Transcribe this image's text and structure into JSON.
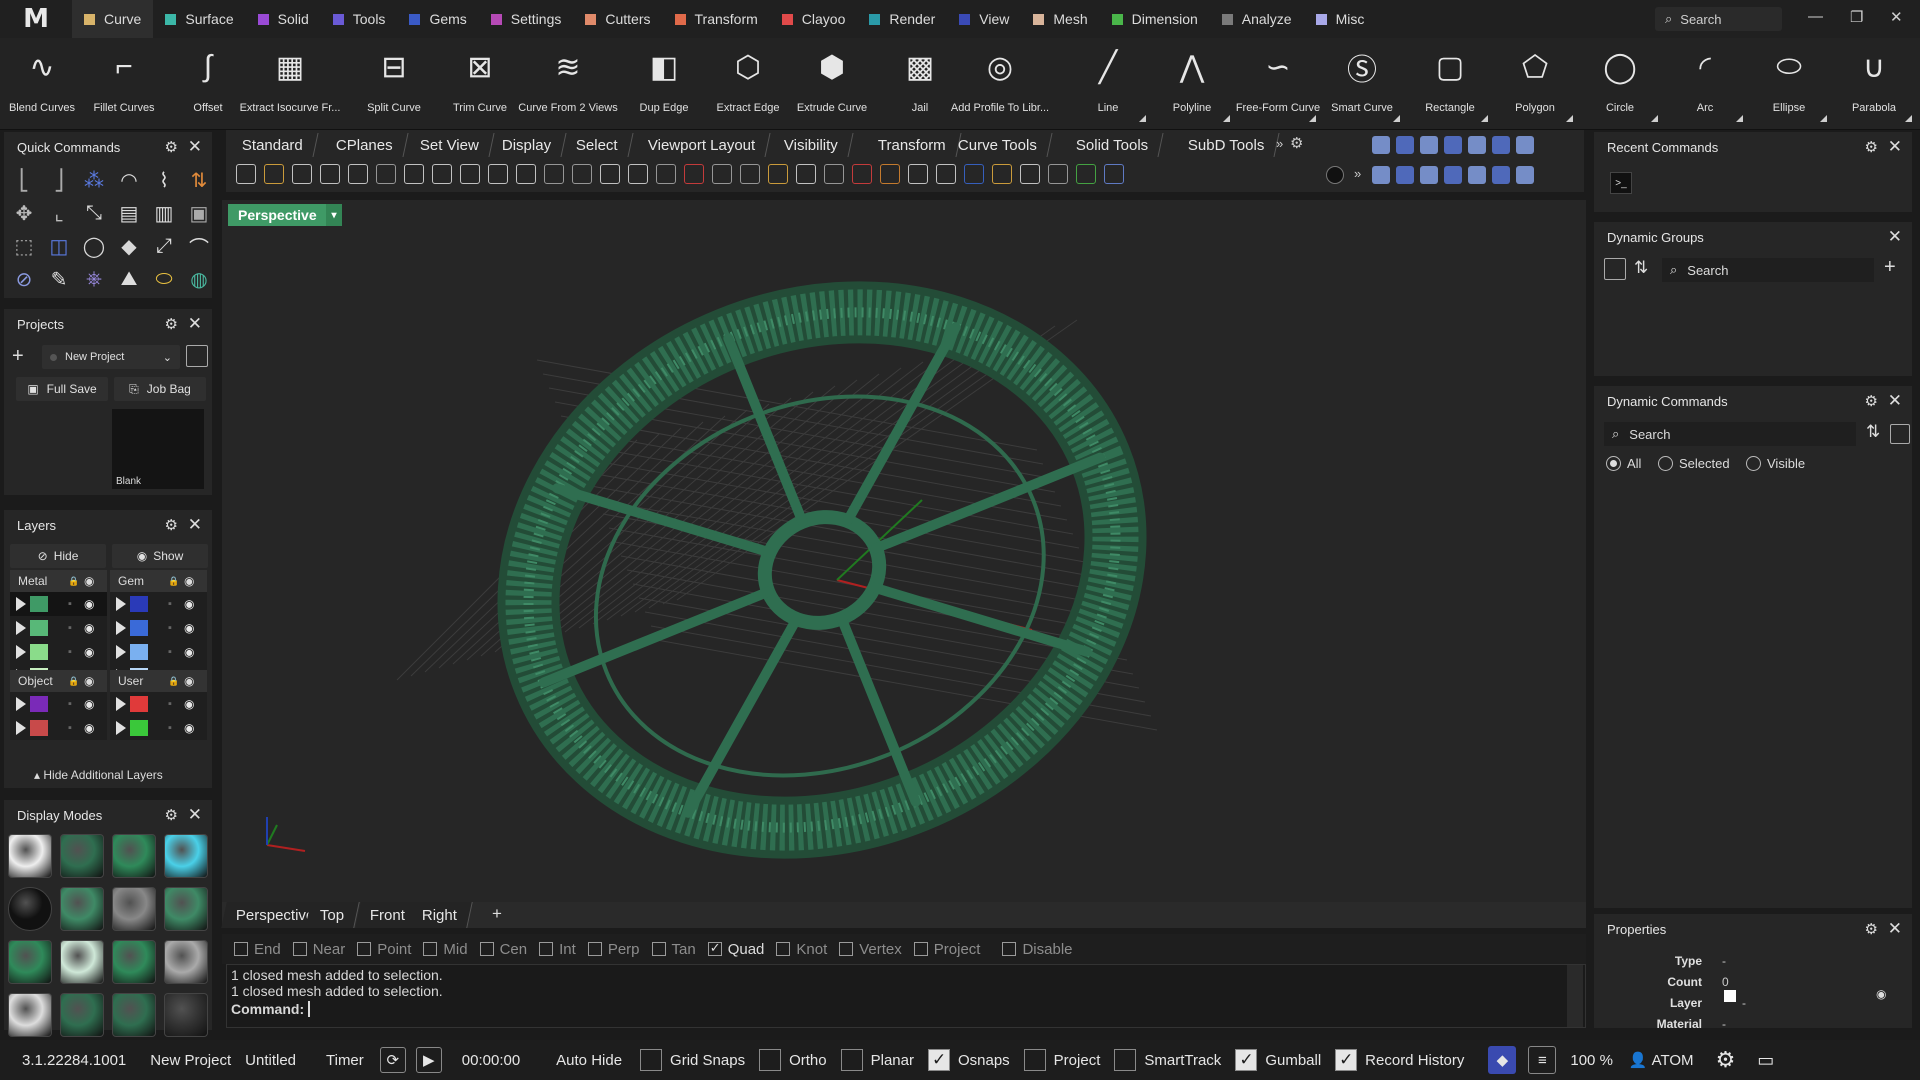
{
  "menubar": {
    "logo": "M",
    "tabs": [
      {
        "label": "Curve",
        "color": "#d8b46a",
        "active": true
      },
      {
        "label": "Surface",
        "color": "#3cb8a8"
      },
      {
        "label": "Solid",
        "color": "#9a4ad6"
      },
      {
        "label": "Tools",
        "color": "#6a5ad6"
      },
      {
        "label": "Gems",
        "color": "#3a5ac6"
      },
      {
        "label": "Settings",
        "color": "#b64ab6"
      },
      {
        "label": "Cutters",
        "color": "#e08a6a"
      },
      {
        "label": "Transform",
        "color": "#e06a4a"
      },
      {
        "label": "Clayoo",
        "color": "#e04a4a"
      },
      {
        "label": "Render",
        "color": "#2a9aa8"
      },
      {
        "label": "View",
        "color": "#3a4ab6"
      },
      {
        "label": "Mesh",
        "color": "#d8b49a"
      },
      {
        "label": "Dimension",
        "color": "#4ab64a"
      },
      {
        "label": "Analyze",
        "color": "#7a7a7a"
      },
      {
        "label": "Misc",
        "color": "#a8a8e8"
      }
    ],
    "search_placeholder": "Search"
  },
  "ribbon": [
    "Blend Curves",
    "Fillet Curves",
    "Offset",
    "Extract Isocurve Fr...",
    "Split Curve",
    "Trim Curve",
    "Curve From 2 Views",
    "Dup Edge",
    "Extract Edge",
    "Extrude Curve",
    "Jail",
    "Add Profile To Libr...",
    "Line",
    "Polyline",
    "Free-Form Curve",
    "Smart Curve",
    "Rectangle",
    "Polygon",
    "Circle",
    "Arc",
    "Ellipse",
    "Parabola"
  ],
  "quick_commands": {
    "title": "Quick Commands"
  },
  "projects": {
    "title": "Projects",
    "project": "New Project",
    "full_save": "Full Save",
    "job_bag": "Job Bag",
    "thumb_label": "Blank"
  },
  "layers": {
    "title": "Layers",
    "hide": "Hide",
    "show": "Show",
    "groups": [
      {
        "name": "Metal",
        "colors": [
          "#3f9a66",
          "#58b878",
          "#8adc8a",
          "#c8f0c0"
        ]
      },
      {
        "name": "Gem",
        "colors": [
          "#2a3ab8",
          "#3a6ad8",
          "#7ab0f0",
          "#b8d8f8"
        ]
      },
      {
        "name": "Object",
        "colors": [
          "#7a2ab8",
          "#c84a4a"
        ]
      },
      {
        "name": "User",
        "colors": [
          "#e03a3a",
          "#3ac83a"
        ]
      }
    ],
    "footer": "Hide Additional Layers"
  },
  "display_modes": {
    "title": "Display Modes"
  },
  "viewport": {
    "tabs": [
      "Standard",
      "CPlanes",
      "Set View",
      "Display",
      "Select",
      "Viewport Layout",
      "Visibility",
      "Transform",
      "Curve Tools",
      "Solid Tools",
      "SubD Tools"
    ],
    "label": "Perspective",
    "bottom_tabs": [
      "Perspective",
      "Top",
      "Front",
      "Right"
    ],
    "add_tab": "+"
  },
  "osnaps": [
    {
      "label": "End",
      "on": false
    },
    {
      "label": "Near",
      "on": false
    },
    {
      "label": "Point",
      "on": false
    },
    {
      "label": "Mid",
      "on": false
    },
    {
      "label": "Cen",
      "on": false
    },
    {
      "label": "Int",
      "on": false
    },
    {
      "label": "Perp",
      "on": false
    },
    {
      "label": "Tan",
      "on": false
    },
    {
      "label": "Quad",
      "on": true
    },
    {
      "label": "Knot",
      "on": false
    },
    {
      "label": "Vertex",
      "on": false
    },
    {
      "label": "Project",
      "on": false
    },
    {
      "label": "Disable",
      "on": false
    }
  ],
  "command": {
    "history": [
      "1 closed mesh added to selection.",
      "1 closed mesh added to selection."
    ],
    "prompt": "Command:"
  },
  "right_panels": {
    "recent": "Recent Commands",
    "dyn_groups": "Dynamic Groups",
    "dyn_groups_search": "Search",
    "dyn_commands": "Dynamic Commands",
    "dyn_commands_search": "Search",
    "filter_all": "All",
    "filter_selected": "Selected",
    "filter_visible": "Visible",
    "properties": "Properties",
    "props": [
      {
        "k": "Type",
        "v": "-"
      },
      {
        "k": "Count",
        "v": "0"
      },
      {
        "k": "Layer",
        "v": "-"
      },
      {
        "k": "Material",
        "v": "-"
      }
    ]
  },
  "status": {
    "version": "3.1.22284.1001",
    "project": "New Project",
    "file": "Untitled",
    "timer": "Timer",
    "time": "00:00:00",
    "autohide": "Auto Hide",
    "toggles": [
      {
        "label": "Grid Snaps",
        "on": false
      },
      {
        "label": "Ortho",
        "on": false
      },
      {
        "label": "Planar",
        "on": false
      },
      {
        "label": "Osnaps",
        "on": true
      },
      {
        "label": "Project",
        "on": false
      },
      {
        "label": "SmartTrack",
        "on": false
      },
      {
        "label": "Gumball",
        "on": true
      },
      {
        "label": "Record History",
        "on": true
      }
    ],
    "zoom": "100 %",
    "user": "ATOM"
  },
  "colors": {
    "accent": "#3f9a66",
    "ring": "#2f6e50"
  }
}
